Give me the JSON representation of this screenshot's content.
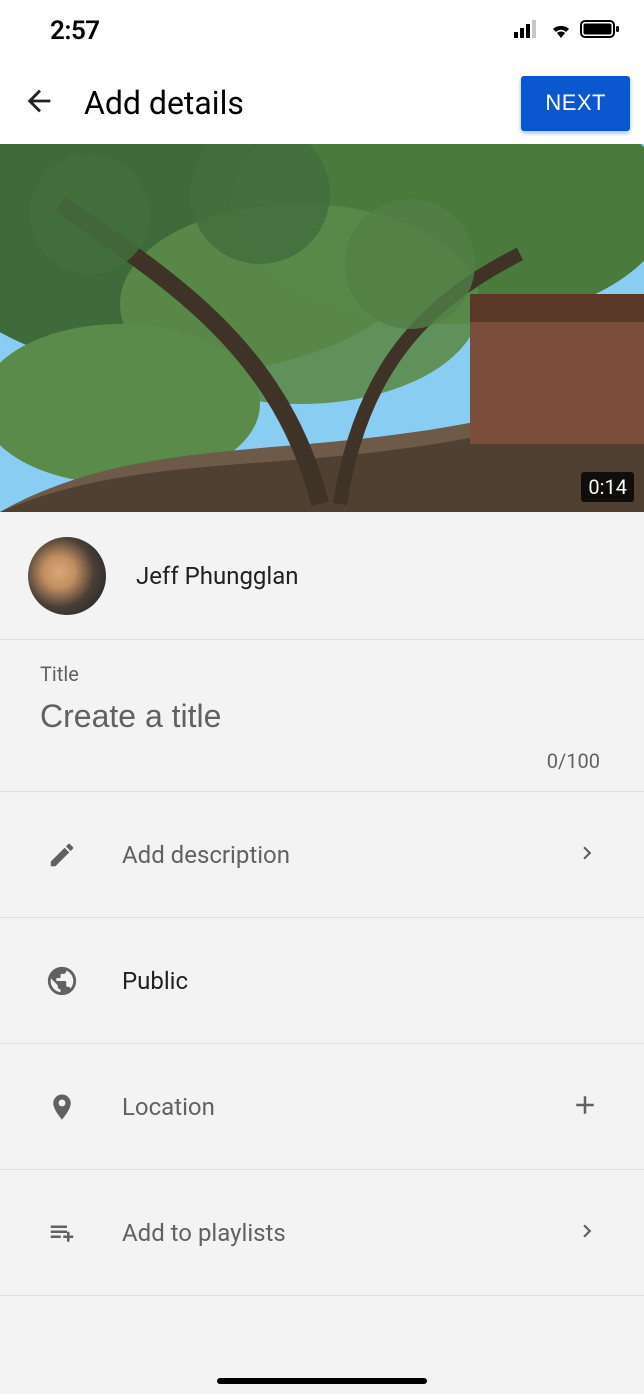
{
  "status": {
    "time": "2:57"
  },
  "header": {
    "title": "Add details",
    "next_label": "NEXT"
  },
  "video": {
    "duration": "0:14"
  },
  "user": {
    "name": "Jeff Phungglan"
  },
  "title_section": {
    "label": "Title",
    "placeholder": "Create a title",
    "value": "",
    "counter": "0/100"
  },
  "options": {
    "description": {
      "label": "Add description"
    },
    "visibility": {
      "label": "Public"
    },
    "location": {
      "label": "Location"
    },
    "playlists": {
      "label": "Add to playlists"
    }
  }
}
